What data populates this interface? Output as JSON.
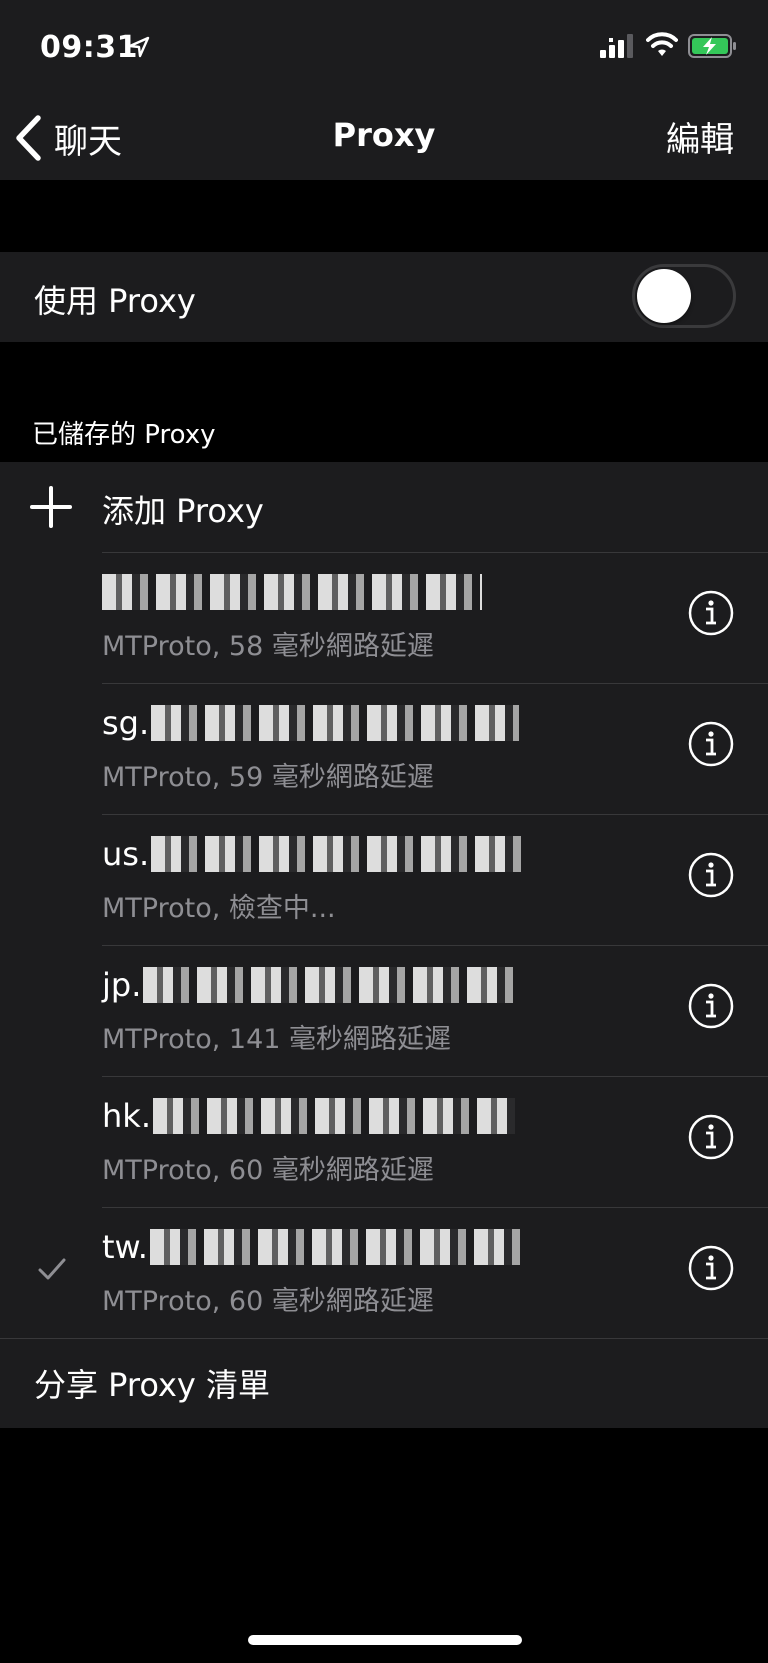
{
  "status_bar": {
    "time": "09:31",
    "icons": [
      "location-arrow-icon",
      "cellular-signal-icon",
      "wifi-icon",
      "battery-charging-icon"
    ],
    "battery_color": "#34c759"
  },
  "nav": {
    "back_label": "聊天",
    "title": "Proxy",
    "edit_label": "編輯"
  },
  "use_proxy": {
    "label": "使用 Proxy",
    "enabled": false
  },
  "saved_section": {
    "header": "已儲存的 Proxy",
    "add_label": "添加 Proxy",
    "proxies": [
      {
        "host_prefix": "",
        "status": "MTProto, 58 毫秒網路延遲",
        "selected": false
      },
      {
        "host_prefix": "sg.",
        "status": "MTProto, 59 毫秒網路延遲",
        "selected": false
      },
      {
        "host_prefix": "us.",
        "status": "MTProto, 檢查中...",
        "selected": false
      },
      {
        "host_prefix": "jp.",
        "status": "MTProto, 141 毫秒網路延遲",
        "selected": false
      },
      {
        "host_prefix": "hk.",
        "status": "MTProto, 60 毫秒網路延遲",
        "selected": false
      },
      {
        "host_prefix": "tw.",
        "status": "MTProto, 60 毫秒網路延遲",
        "selected": true
      }
    ],
    "share_label": "分享 Proxy 清單"
  },
  "colors": {
    "background": "#000000",
    "card": "#1c1c1e",
    "secondary_text": "#8e8e93",
    "separator": "#38383a"
  }
}
